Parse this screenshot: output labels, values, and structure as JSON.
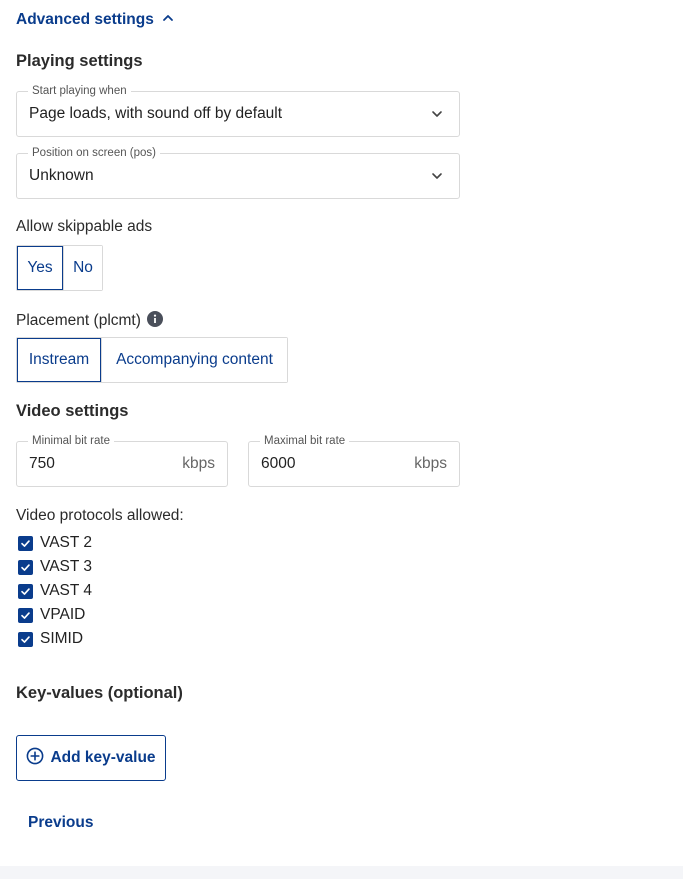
{
  "advanced_settings": {
    "label": "Advanced settings",
    "icon": "chevron-up-icon"
  },
  "playing_settings": {
    "heading": "Playing settings",
    "start_playing": {
      "label": "Start playing when",
      "value": "Page loads, with sound off by default"
    },
    "position": {
      "label": "Position on screen (pos)",
      "value": "Unknown"
    },
    "skippable": {
      "label": "Allow skippable ads",
      "options": [
        "Yes",
        "No"
      ],
      "selected": "Yes"
    },
    "placement": {
      "label": "Placement (plcmt)",
      "options": [
        "Instream",
        "Accompanying content"
      ],
      "selected": "Instream"
    }
  },
  "video_settings": {
    "heading": "Video settings",
    "min_bitrate": {
      "label": "Minimal bit rate",
      "value": "750",
      "unit": "kbps"
    },
    "max_bitrate": {
      "label": "Maximal bit rate",
      "value": "6000",
      "unit": "kbps"
    },
    "protocols": {
      "label": "Video protocols allowed:",
      "items": [
        {
          "label": "VAST 2",
          "checked": true
        },
        {
          "label": "VAST 3",
          "checked": true
        },
        {
          "label": "VAST 4",
          "checked": true
        },
        {
          "label": "VPAID",
          "checked": true
        },
        {
          "label": "SIMID",
          "checked": true
        }
      ]
    }
  },
  "key_values": {
    "heading": "Key-values (optional)",
    "add_button_label": "Add key-value"
  },
  "navigation": {
    "previous_label": "Previous"
  },
  "colors": {
    "accent": "#0a3c8c",
    "border": "#d9d9d9"
  }
}
